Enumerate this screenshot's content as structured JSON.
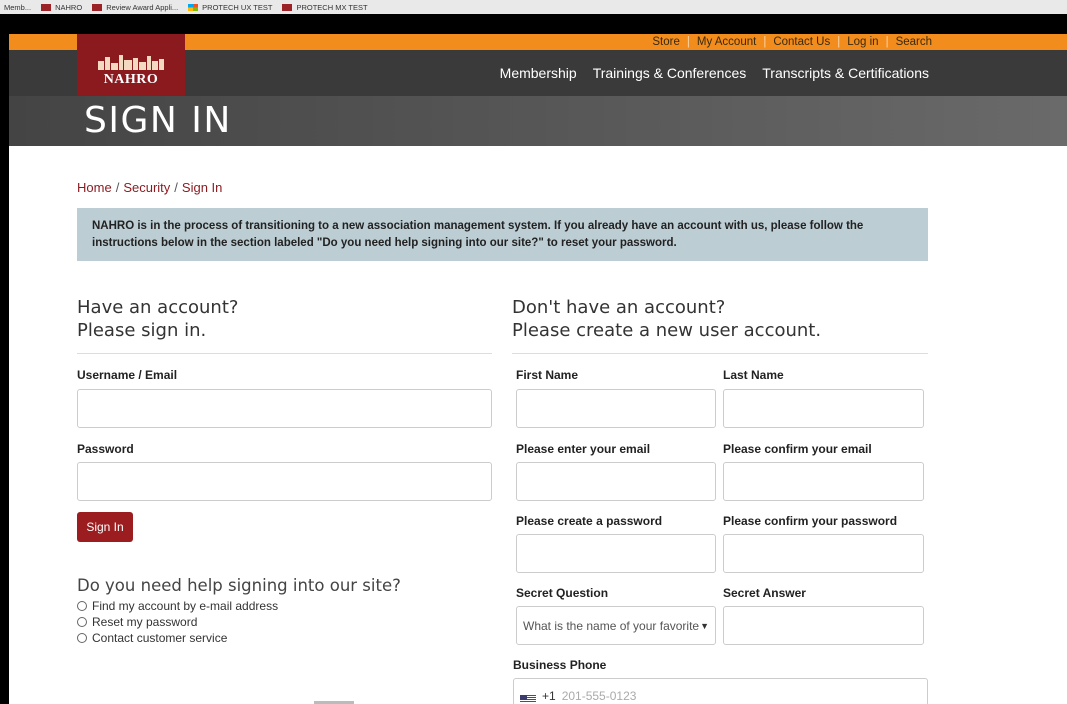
{
  "bookmarks": [
    {
      "label": "Memb...",
      "icon": "none"
    },
    {
      "label": "NAHRO",
      "icon": "nahro-favicon"
    },
    {
      "label": "Review Award Appli...",
      "icon": "nahro-favicon"
    },
    {
      "label": "PROTECH UX TEST",
      "icon": "microsoft-favicon"
    },
    {
      "label": "PROTECH MX TEST",
      "icon": "nahro-favicon"
    }
  ],
  "utility": [
    "Store",
    "My Account",
    "Contact Us",
    "Log in",
    "Search"
  ],
  "logo": {
    "text": "NAHRO"
  },
  "nav": [
    "Membership",
    "Trainings & Conferences",
    "Transcripts & Certifications"
  ],
  "page_title": "SIGN IN",
  "breadcrumb": [
    "Home",
    "Security",
    "Sign In"
  ],
  "notice": "NAHRO is in the process of transitioning to a new association management system. If you already have an account with us, please follow the instructions below in the section labeled \"Do you need help signing into our site?\" to reset your password.",
  "signin": {
    "heading_line1": "Have an account?",
    "heading_line2": "Please sign in.",
    "username_label": "Username / Email",
    "password_label": "Password",
    "button": "Sign In"
  },
  "help": {
    "heading": "Do you need help signing into our site?",
    "options": [
      "Find my account by e-mail address",
      "Reset my password",
      "Contact customer service"
    ]
  },
  "register": {
    "heading_line1": "Don't have an account?",
    "heading_line2": "Please create a new user account.",
    "first_name": "First Name",
    "last_name": "Last Name",
    "email": "Please enter your email",
    "email_confirm": "Please confirm your email",
    "password": "Please create a password",
    "password_confirm": "Please confirm your password",
    "secret_question": "Secret Question",
    "secret_question_value": "What is the name of your favorite",
    "secret_answer": "Secret Answer",
    "business_phone": "Business Phone",
    "phone_code": "+1",
    "phone_placeholder": "201-555-0123"
  },
  "colors": {
    "accent": "#9b1d20",
    "utility_bar": "#f28c1c",
    "nav": "#3a3a3a",
    "notice": "#bccdd3"
  }
}
